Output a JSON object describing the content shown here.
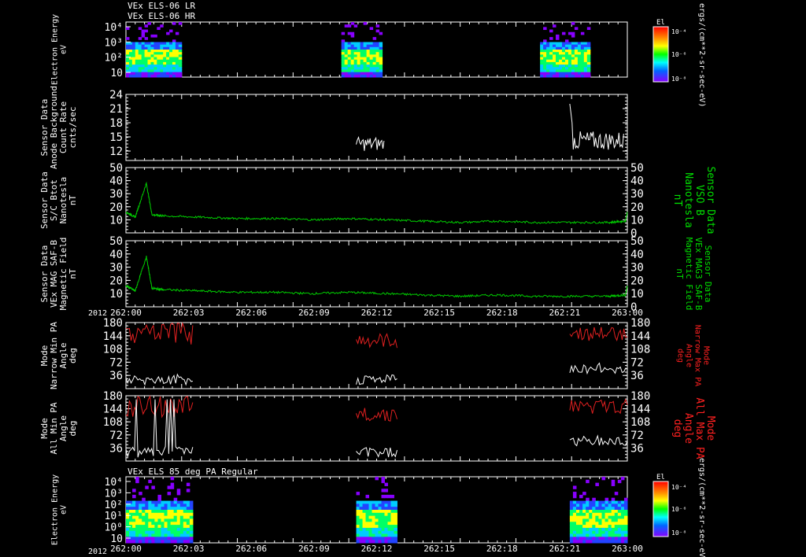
{
  "header": {
    "line1": "VEx ELS-06 LR",
    "line2": "VEx ELS-06 HR",
    "bottom_panel_title": "VEx ELS 85 deg PA Regular",
    "year": "2012"
  },
  "colors": {
    "background": "#000000",
    "white_trace": "#ffffff",
    "green_trace": "#00cc00",
    "red_trace": "#e02020",
    "green_label": "#00dd00",
    "red_label": "#ff2020"
  },
  "colorbar": {
    "top": {
      "title": "El",
      "ticks": [
        "10⁻⁴",
        "10⁻⁶",
        "10⁻⁸"
      ],
      "unit": "ergs/(cm**2-sr-sec-eV)"
    },
    "bottom": {
      "title": "El",
      "ticks": [
        "10⁻⁴",
        "10⁻⁶",
        "10⁻⁸"
      ],
      "unit": "ergs/(cm**2-sr-sec-eV)"
    }
  },
  "chart_data": [
    {
      "type": "heatmap",
      "panel": "electron-energy-top",
      "ylabel": [
        "Electron Energy",
        "eV"
      ],
      "yticks": [
        "10⁴",
        "10³",
        "10²",
        "10"
      ],
      "log_y": true,
      "data_blocks_minutes": [
        [
          0.0,
          3.0
        ],
        [
          11.6,
          13.8
        ],
        [
          22.3,
          25.0
        ]
      ],
      "grid": false
    },
    {
      "type": "line",
      "panel": "anode-background",
      "ylabel": [
        "Sensor Data",
        "Anode Background",
        "Count Rate",
        "cnts/sec"
      ],
      "yticks": [
        24,
        21,
        18,
        15,
        12
      ],
      "ylim": [
        10,
        24
      ],
      "series": [
        {
          "color": "white",
          "segments": [
            [
              12.4,
              13.9
            ],
            [
              23.9,
              26.8
            ]
          ],
          "mean": [
            13.5,
            14.2
          ],
          "spread": [
            3.0,
            4.0
          ]
        }
      ]
    },
    {
      "type": "line",
      "panel": "bmag-sc",
      "ylabel": [
        "Sensor Data",
        "S/C Btot",
        "Nanotesla",
        "nT"
      ],
      "right_label": [
        "Sensor Data",
        "VSO B",
        "Nanotesla",
        "nT"
      ],
      "yticks": [
        50,
        40,
        30,
        20,
        10
      ],
      "right_yticks": [
        50,
        40,
        30,
        20,
        10,
        0
      ],
      "ylim": [
        0,
        50
      ],
      "series": [
        {
          "color": "green",
          "x": [
            0.0,
            0.5,
            1.1,
            1.4,
            2.0,
            4.0,
            6.0,
            8.0,
            10.0,
            12.0,
            14.0,
            16.0,
            18.0,
            20.0,
            22.0,
            24.0,
            26.0,
            26.9,
            27.0
          ],
          "y": [
            16,
            12,
            38,
            14,
            13,
            12,
            11,
            11,
            10,
            11,
            10,
            9,
            8,
            9,
            8,
            8,
            8,
            9,
            16
          ]
        }
      ]
    },
    {
      "type": "line",
      "panel": "bmag-mag",
      "ylabel": [
        "Sensor Data",
        "VEx MAG SAF-B",
        "Magnetic Field",
        "nT"
      ],
      "right_label": [
        "Sensor Data",
        "VEx MAG3 SAF-B",
        "Magnetic Field",
        "nT"
      ],
      "yticks": [
        50,
        40,
        30,
        20,
        10
      ],
      "right_yticks": [
        50,
        40,
        30,
        20,
        10,
        0
      ],
      "ylim": [
        0,
        50
      ],
      "xticks": [
        "262:00",
        "262:03",
        "262:06",
        "262:09",
        "262:12",
        "262:15",
        "262:18",
        "262:21",
        "263:00"
      ],
      "series": [
        {
          "color": "green",
          "x": [
            0.0,
            0.5,
            1.1,
            1.4,
            2.0,
            4.0,
            6.0,
            8.0,
            10.0,
            12.0,
            14.0,
            16.0,
            18.0,
            20.0,
            22.0,
            24.0,
            26.0,
            26.9,
            27.0
          ],
          "y": [
            16,
            12,
            38,
            14,
            13,
            12,
            11,
            11,
            10,
            11,
            10,
            9,
            8,
            9,
            8,
            8,
            8,
            9,
            16
          ]
        }
      ]
    },
    {
      "type": "line",
      "panel": "pa-narrow",
      "ylabel": [
        "Mode",
        "Narrow Min PA",
        "Angle",
        "deg"
      ],
      "right_label": [
        "Mode",
        "Narrow Max PA",
        "Angle",
        "deg"
      ],
      "yticks": [
        180,
        144,
        108,
        72,
        36
      ],
      "right_yticks": [
        180,
        144,
        108,
        72,
        36
      ],
      "ylim": [
        0,
        180
      ],
      "segments_minutes": [
        [
          0.0,
          3.6
        ],
        [
          12.4,
          14.6
        ],
        [
          23.9,
          27.0
        ]
      ]
    },
    {
      "type": "line",
      "panel": "pa-all",
      "ylabel": [
        "Mode",
        "All Min PA",
        "Angle",
        "deg"
      ],
      "right_label": [
        "Mode",
        "All Max PA",
        "Angle",
        "deg"
      ],
      "yticks": [
        180,
        144,
        108,
        72,
        36
      ],
      "right_yticks": [
        180,
        144,
        108,
        72,
        36
      ],
      "ylim": [
        0,
        180
      ],
      "segments_minutes": [
        [
          0.0,
          3.6
        ],
        [
          12.4,
          14.6
        ],
        [
          23.9,
          27.0
        ]
      ]
    },
    {
      "type": "heatmap",
      "panel": "electron-energy-bottom",
      "ylabel": [
        "Electron Energy",
        "eV"
      ],
      "yticks": [
        "10⁴",
        "10³",
        "10²",
        "10¹",
        "10⁰",
        "10"
      ],
      "log_y": true,
      "xticks": [
        "262:00",
        "262:03",
        "262:06",
        "262:09",
        "262:12",
        "262:15",
        "262:18",
        "262:21",
        "263:00"
      ],
      "data_blocks_minutes": [
        [
          0.0,
          3.6
        ],
        [
          12.4,
          14.6
        ],
        [
          23.9,
          27.0
        ]
      ],
      "grid": false
    }
  ]
}
